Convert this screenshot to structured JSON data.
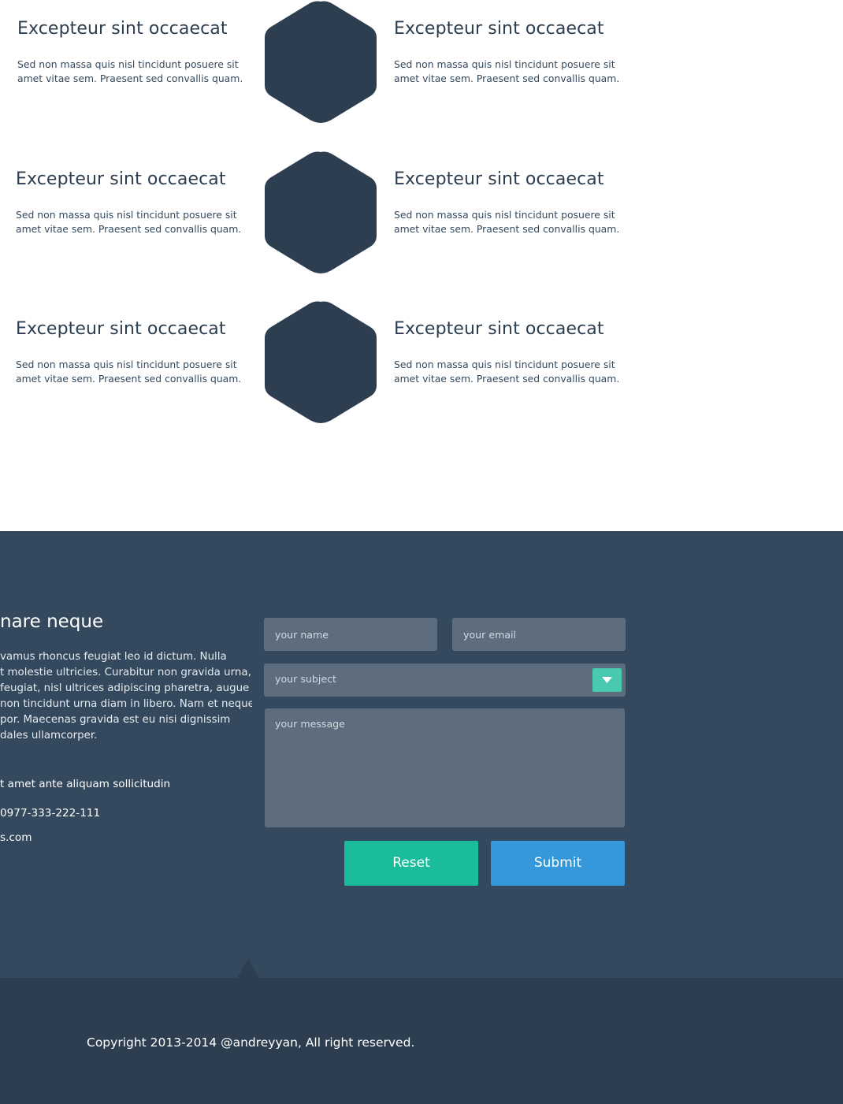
{
  "features": {
    "rows": [
      {
        "left": {
          "title": "Excepteur sint occaecat",
          "text": "Sed non massa quis nisl tincidunt posuere sit amet vitae sem. Praesent sed convallis quam."
        },
        "right": {
          "title": "Excepteur sint occaecat",
          "text": "Sed non massa quis nisl tincidunt posuere sit amet vitae sem. Praesent sed convallis quam."
        }
      },
      {
        "left": {
          "title": "Excepteur sint occaecat",
          "text": "Sed non massa quis nisl tincidunt posuere sit amet vitae sem. Praesent sed convallis quam."
        },
        "right": {
          "title": "Excepteur sint occaecat",
          "text": "Sed non massa quis nisl tincidunt posuere sit amet vitae sem. Praesent sed convallis quam."
        }
      },
      {
        "left": {
          "title": "Excepteur sint occaecat",
          "text": "Sed non massa quis nisl tincidunt posuere sit amet vitae sem. Praesent sed convallis quam."
        },
        "right": {
          "title": "Excepteur sint occaecat",
          "text": "Sed non massa quis nisl tincidunt posuere sit amet vitae sem. Praesent sed convallis quam."
        }
      }
    ],
    "hex_icon": "hexagon-icon",
    "hex_color": "#2c3e50"
  },
  "contact": {
    "title": "nare neque",
    "text": "vamus rhoncus feugiat leo id dictum. Nulla t molestie ultricies. Curabitur non gravida urna, feugiat, nisl ultrices adipiscing pharetra, augue non tincidunt urna diam in libero. Nam et neque por. Maecenas gravida est eu nisi dignissim dales ullamcorper.",
    "text_lines": [
      "vamus rhoncus feugiat leo id dictum. Nulla",
      "t molestie ultricies. Curabitur non gravida urna,",
      "feugiat, nisl ultrices adipiscing pharetra, augue",
      "non tincidunt urna diam in libero. Nam et neque",
      "por. Maecenas gravida est eu nisi dignissim",
      "dales ullamcorper."
    ],
    "address": "t amet ante aliquam sollicitudin",
    "phone": "0977-333-222-111",
    "email": "s.com",
    "background": "#34495e"
  },
  "form": {
    "name_placeholder": "your name",
    "email_placeholder": "your email",
    "subject_label": "your subject",
    "subject_dropdown_icon": "chevron-down-icon",
    "message_placeholder": "your message",
    "reset_label": "Reset",
    "submit_label": "Submit",
    "reset_color": "#1abc9c",
    "submit_color": "#3498db",
    "dropdown_color": "#48c9b0"
  },
  "footer": {
    "copyright": "Copyright 2013-2014 @andreyyan, All right reserved.",
    "background": "#2c3e50"
  }
}
